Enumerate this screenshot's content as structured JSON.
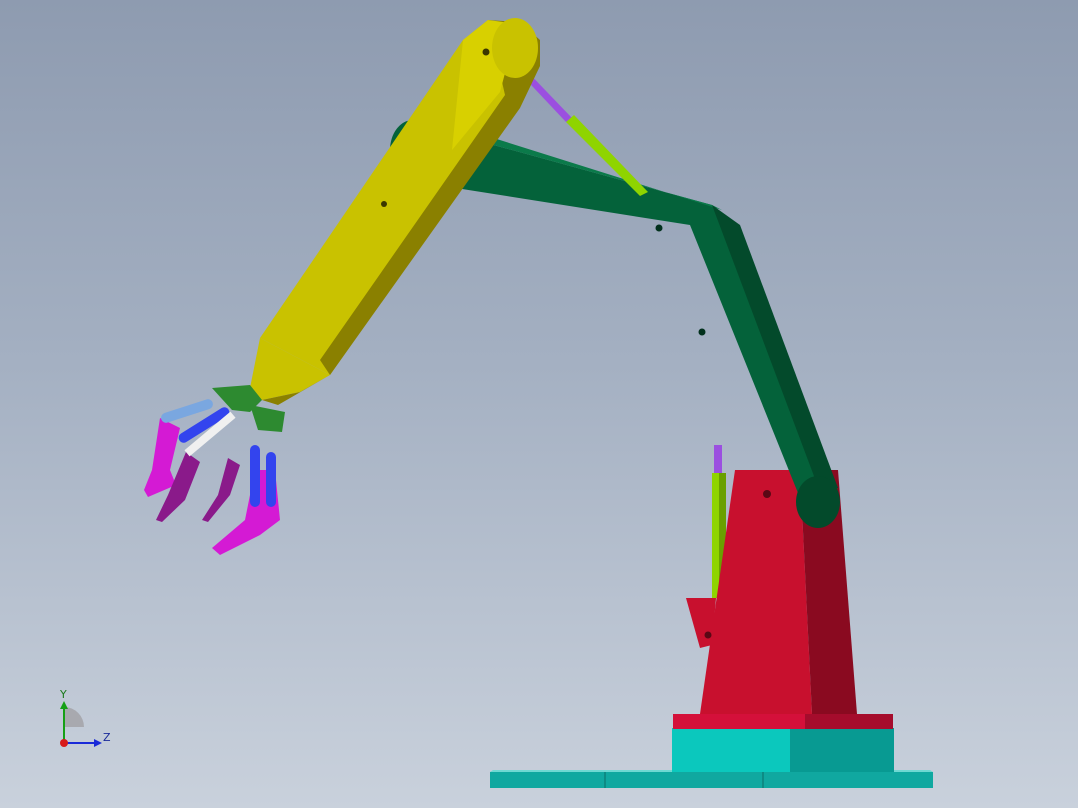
{
  "viewport": {
    "background_top": "#8e9bb0",
    "background_bottom": "#c9d1dc"
  },
  "model": {
    "colors": {
      "upper_arm": "#c9c200",
      "lower_arm": "#04623a",
      "base_column": "#c8102e",
      "turntable": "#0bb8b0",
      "piston_rod": "#8fd400",
      "piston_link": "#9b4fe0",
      "gripper_finger": "#d41ad4",
      "gripper_link": "#3344ee"
    }
  },
  "triad": {
    "y_label": "Y",
    "z_label": "Z",
    "y_color": "#16a016",
    "z_color": "#1a2ad8",
    "origin_color": "#d81a1a"
  }
}
